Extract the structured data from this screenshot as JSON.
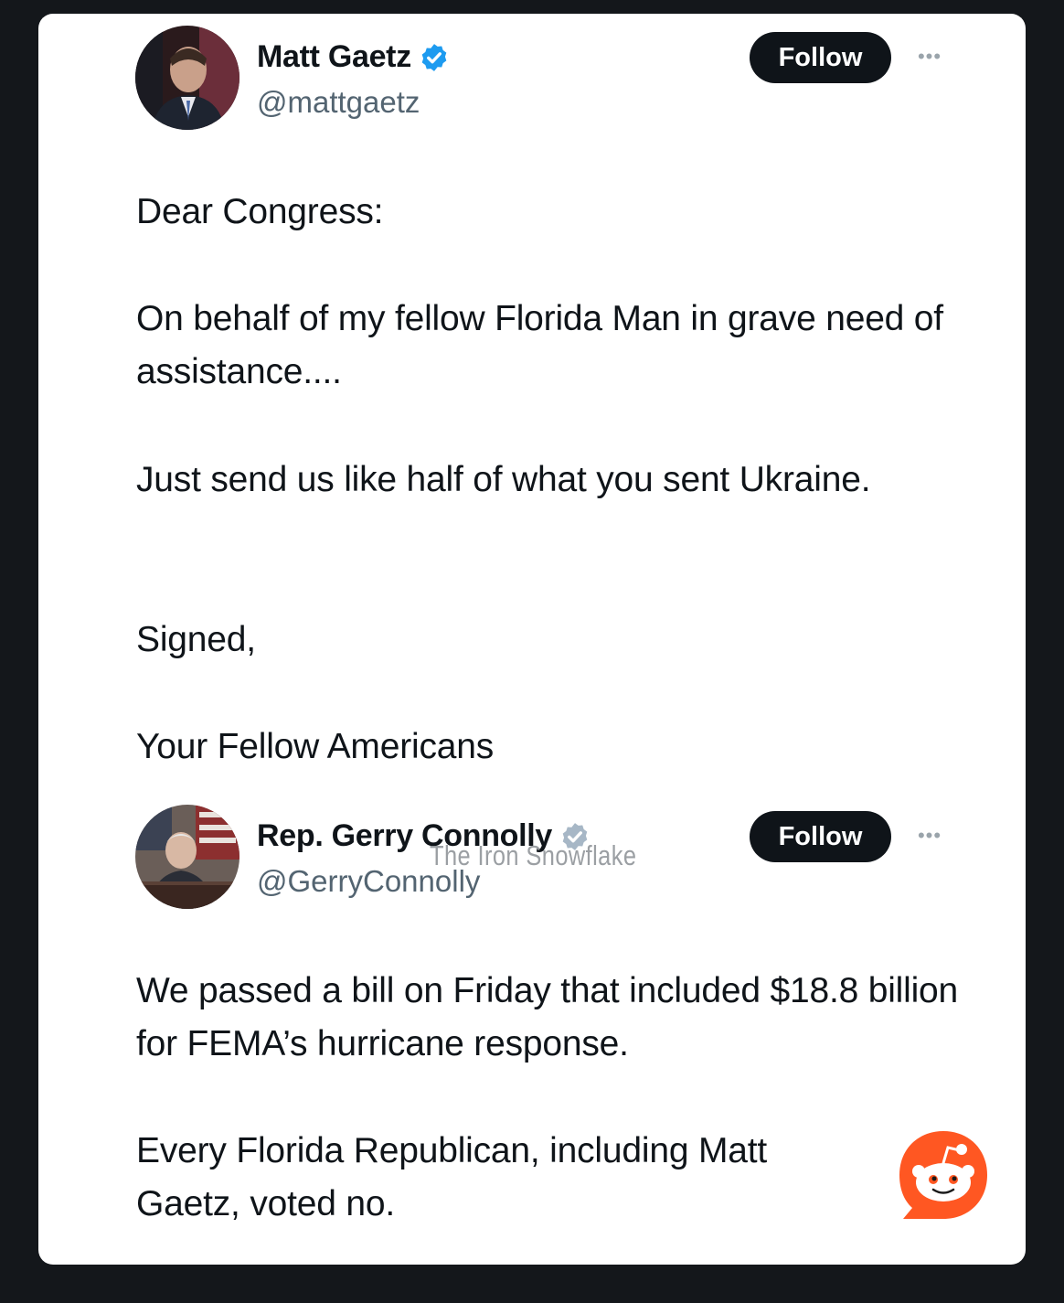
{
  "tweet1": {
    "name": "Matt Gaetz",
    "handle": "@mattgaetz",
    "follow_label": "Follow",
    "more_label": "•••",
    "paragraphs": [
      "Dear Congress:",
      "On behalf of my fellow Florida Man in grave need of assistance....",
      "Just send us like half of what you sent Ukraine.",
      "Signed,",
      "Your Fellow Americans"
    ]
  },
  "tweet2": {
    "name": "Rep. Gerry Connolly",
    "handle": "@GerryConnolly",
    "follow_label": "Follow",
    "more_label": "•••",
    "paragraphs": [
      "We passed a bill on Friday that included $18.8 billion for FEMA’s hurricane response.",
      "Every Florida Republican, including Matt Gaetz, voted no."
    ]
  },
  "watermark": "The Iron Snowflake",
  "colors": {
    "page_bg": "#14171b",
    "card_bg": "#ffffff",
    "text": "#0f1419",
    "secondary_text": "#536471",
    "verified": "#1d9bf0",
    "follow_bg": "#0f1419",
    "reddit_orange": "#ff5722"
  },
  "icons": {
    "verified": "verified-badge-icon",
    "more": "more-options-icon",
    "reddit": "reddit-snoo-icon"
  }
}
